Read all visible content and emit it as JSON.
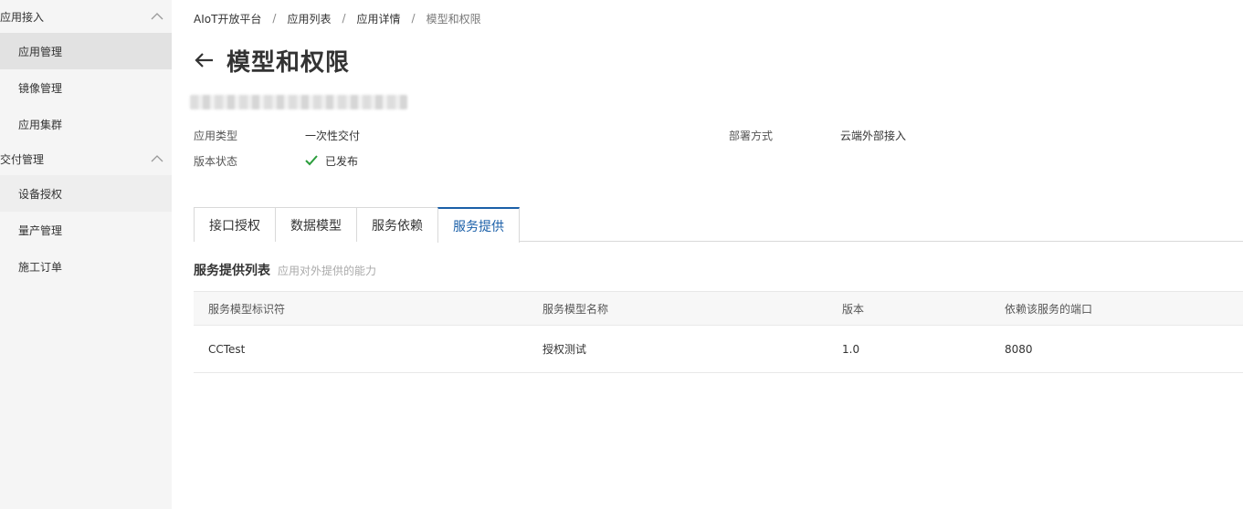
{
  "sidebar": {
    "groups": [
      {
        "title": "应用接入",
        "items": [
          "应用管理",
          "镜像管理",
          "应用集群"
        ]
      },
      {
        "title": "交付管理",
        "items": [
          "设备授权",
          "量产管理",
          "施工订单"
        ]
      }
    ],
    "active_item": "应用管理",
    "icons": {
      "group_toggle": "chevron-up-icon"
    }
  },
  "breadcrumb": [
    "AIoT开放平台",
    "应用列表",
    "应用详情",
    "模型和权限"
  ],
  "page": {
    "title": "模型和权限",
    "back_icon": "arrow-left-icon"
  },
  "app_info": {
    "type_label": "应用类型",
    "type_value": "一次性交付",
    "deploy_label": "部署方式",
    "deploy_value": "云端外部接入",
    "status_label": "版本状态",
    "status_value": "已发布",
    "status_icon": "check-icon",
    "status_color": "#2a9d3c"
  },
  "tabs": [
    {
      "label": "接口授权",
      "active": false
    },
    {
      "label": "数据模型",
      "active": false
    },
    {
      "label": "服务依赖",
      "active": false
    },
    {
      "label": "服务提供",
      "active": true
    }
  ],
  "accent_color": "#1a5fa8",
  "section": {
    "title": "服务提供列表",
    "subtitle": "应用对外提供的能力"
  },
  "table": {
    "columns": [
      "服务模型标识符",
      "服务模型名称",
      "版本",
      "依赖该服务的端口"
    ],
    "rows": [
      [
        "CCTest",
        "授权测试",
        "1.0",
        "8080"
      ]
    ]
  }
}
